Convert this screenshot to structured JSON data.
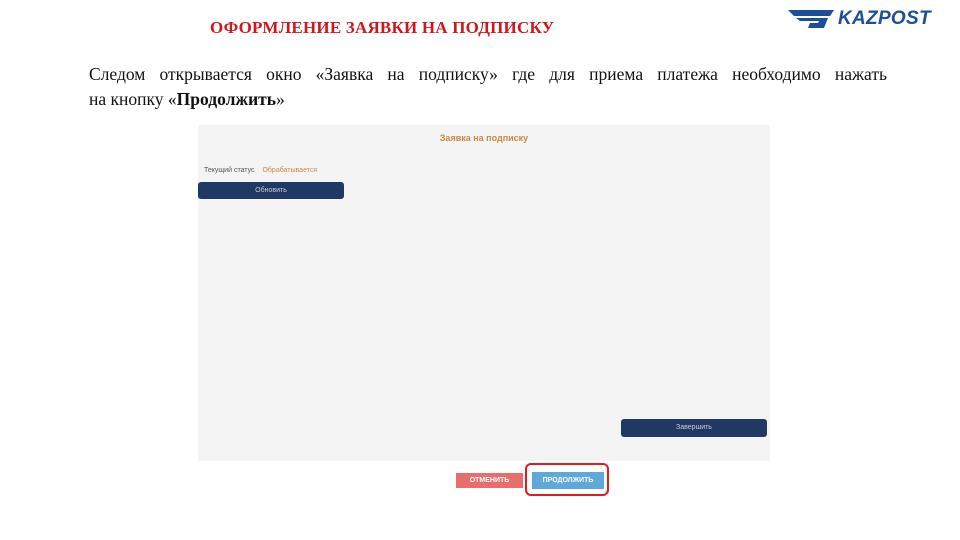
{
  "slide": {
    "title": "ОФОРМЛЕНИЕ ЗАЯВКИ НА ПОДПИСКУ",
    "logo_text": "KAZPOST",
    "body_line1": "Следом открывается окно «Заявка на подписку» где для приема платежа необходимо нажать",
    "body_line2_prefix": "на кнопку «",
    "body_line2_bold": "Продолжить",
    "body_line2_suffix": "»"
  },
  "dialog": {
    "title": "Заявка на подписку",
    "status_label": "Текущий статус",
    "status_value": "Обрабатывается",
    "refresh_label": "Обновить",
    "finish_label": "Завершить"
  },
  "actions": {
    "cancel_label": "ОТМЕНИТЬ",
    "continue_label": "ПРОДОЛЖИТЬ"
  },
  "colors": {
    "title_red": "#d0171b",
    "brand_blue": "#1b4f9c",
    "dialog_dark_button": "#1f3864",
    "accent_orange": "#c98a45",
    "cancel_red": "#e86d6d",
    "continue_blue": "#5fa8dc",
    "highlight_red": "#e01d1d"
  },
  "icons": {
    "logo_mark": "kazpost-logo-icon"
  }
}
